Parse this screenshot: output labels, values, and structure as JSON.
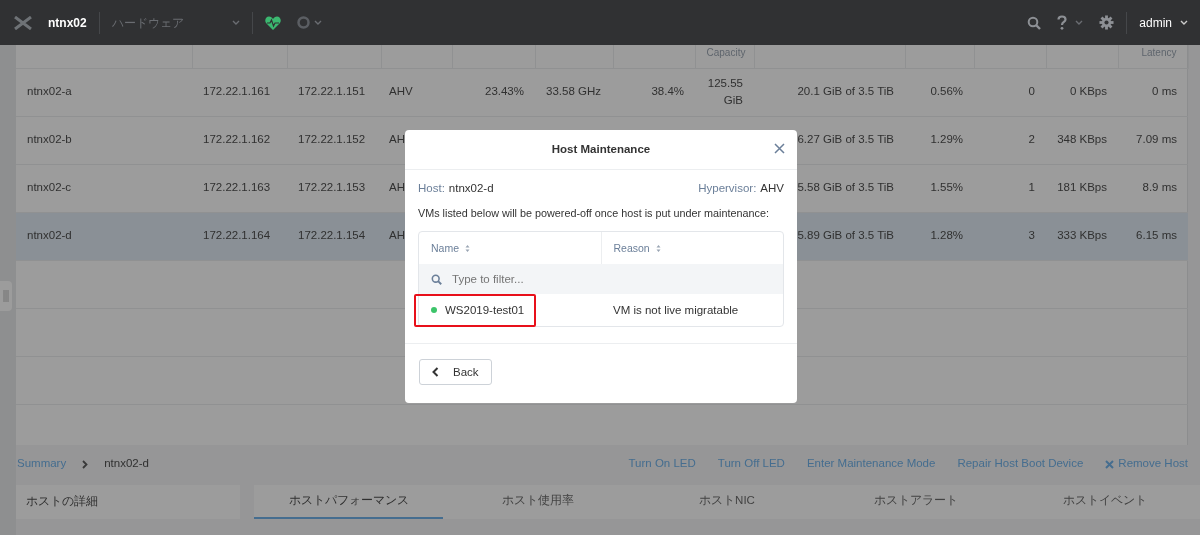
{
  "navbar": {
    "cluster": "ntnx02",
    "section": "ハードウェア",
    "user": "admin"
  },
  "table": {
    "columns": [
      {},
      {},
      {},
      {},
      {},
      {},
      {},
      {
        "label": "Capacity"
      },
      {},
      {},
      {},
      {},
      {
        "label": "Latency"
      }
    ],
    "rows": [
      {
        "selected": false,
        "cells": [
          "ntnx02-a",
          "172.22.1.161",
          "172.22.1.151",
          "AHV",
          "23.43%",
          "33.58 GHz",
          "38.4%",
          "125.55 GiB",
          "20.1 GiB of 3.5 TiB",
          "0.56%",
          "0",
          "0 KBps",
          "0 ms"
        ]
      },
      {
        "selected": false,
        "cells": [
          "ntnx02-b",
          "172.22.1.162",
          "172.22.1.152",
          "AH",
          null,
          null,
          null,
          null,
          "6.27 GiB of 3.5 TiB",
          "1.29%",
          "2",
          "348 KBps",
          "7.09 ms"
        ]
      },
      {
        "selected": false,
        "cells": [
          "ntnx02-c",
          "172.22.1.163",
          "172.22.1.153",
          "AH",
          null,
          null,
          null,
          null,
          "5.58 GiB of 3.5 TiB",
          "1.55%",
          "1",
          "181 KBps",
          "8.9 ms"
        ]
      },
      {
        "selected": true,
        "cells": [
          "ntnx02-d",
          "172.22.1.164",
          "172.22.1.154",
          "AH",
          null,
          null,
          null,
          null,
          "5.89 GiB of 3.5 TiB",
          "1.28%",
          "3",
          "333 KBps",
          "6.15 ms"
        ]
      }
    ]
  },
  "breadcrumb": {
    "root": "Summary",
    "current": "ntnx02-d"
  },
  "actions": [
    {
      "label": "Turn On LED",
      "kind": "link"
    },
    {
      "label": "Turn Off LED",
      "kind": "link"
    },
    {
      "label": "Enter Maintenance Mode",
      "kind": "link"
    },
    {
      "label": "Repair Host Boot Device",
      "kind": "link"
    },
    {
      "label": "Remove Host",
      "kind": "remove"
    }
  ],
  "details_title": "ホストの詳細",
  "tabs": [
    {
      "label": "ホストパフォーマンス",
      "selected": true
    },
    {
      "label": "ホスト使用率",
      "selected": false
    },
    {
      "label": "ホストNIC",
      "selected": false
    },
    {
      "label": "ホストアラート",
      "selected": false
    },
    {
      "label": "ホストイベント",
      "selected": false
    }
  ],
  "modal": {
    "title": "Host Maintenance",
    "host_label": "Host:",
    "host": "ntnx02-d",
    "hypervisor_label": "Hypervisor:",
    "hypervisor": "AHV",
    "message": "VMs listed below will be powered-off once host is put under maintenance:",
    "columns": [
      "Name",
      "Reason"
    ],
    "filter": {
      "placeholder": "Type to filter..."
    },
    "vms": [
      {
        "name": "WS2019-test01",
        "reason": "VM is not live migratable",
        "color": "#3cc46a",
        "highlighted": true
      }
    ],
    "back_button": "Back"
  }
}
